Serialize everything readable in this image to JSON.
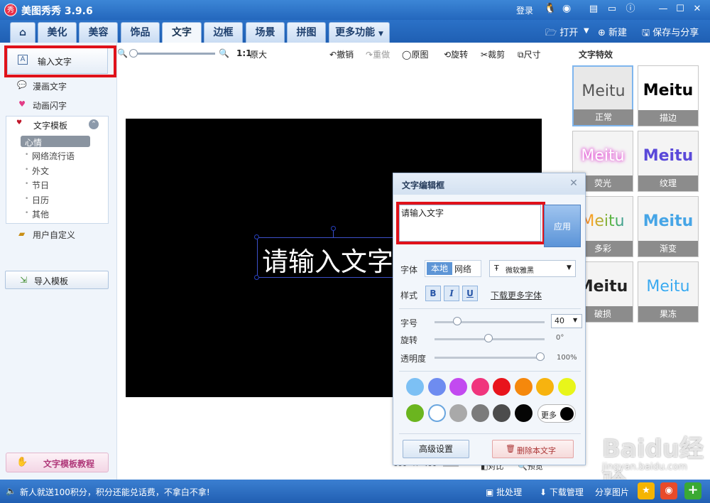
{
  "titlebar": {
    "app_name": "美图秀秀 3.9.6",
    "login": "登录"
  },
  "tabs": [
    "美化",
    "美容",
    "饰品",
    "文字",
    "边框",
    "场景",
    "拼图",
    "更多功能"
  ],
  "header_actions": {
    "open": "打开",
    "new": "新建",
    "save_share": "保存与分享"
  },
  "left_panel": {
    "input_text": "输入文字",
    "comic_text": "漫画文字",
    "animated_text": "动画闪字",
    "template_title": "文字模板",
    "template_items": [
      "心情",
      "网络流行语",
      "外文",
      "节日",
      "日历",
      "其他"
    ],
    "user_custom": "用户自定义",
    "import_template": "导入模板",
    "tutorial": "文字模板教程"
  },
  "toolbar": {
    "ratio": "1:1",
    "original_size": "原大",
    "undo": "撤销",
    "redo": "重做",
    "original": "原图",
    "rotate": "旋转",
    "crop": "裁剪",
    "size": "尺寸"
  },
  "canvas": {
    "text": "请输入文字",
    "width": "600",
    "x_sep": "×",
    "height": "400",
    "exif": "EXIF",
    "compare": "对比",
    "preview": "预览"
  },
  "effects": {
    "title": "文字特效",
    "items": [
      {
        "word": "Meitu",
        "label": "正常"
      },
      {
        "word": "Meitu",
        "label": "描边"
      },
      {
        "word": "Meitu",
        "label": "荧光"
      },
      {
        "word": "Meitu",
        "label": "纹理"
      },
      {
        "word": "Meitu",
        "label": "多彩"
      },
      {
        "word": "Meitu",
        "label": "渐变"
      },
      {
        "word": "Meitu",
        "label": "破损"
      },
      {
        "word": "Meitu",
        "label": "果冻"
      }
    ]
  },
  "editor": {
    "title": "文字编辑框",
    "text_value": "请输入文字",
    "apply": "应用",
    "font_label": "字体",
    "font_local": "本地",
    "font_online": "网络",
    "font_name": "微软雅黑",
    "style_label": "样式",
    "bold": "B",
    "italic": "I",
    "underline": "U",
    "download_fonts": "下载更多字体",
    "size_label": "字号",
    "size_value": "40",
    "rotate_label": "旋转",
    "rotate_value": "0°",
    "opacity_label": "透明度",
    "opacity_value": "100%",
    "opacity_fraction": 1.0,
    "colors_row1": [
      "#7cc0f4",
      "#6e8cf0",
      "#c24af0",
      "#f0357d",
      "#e8141c",
      "#f5880c",
      "#f7b30f",
      "#e8f51a"
    ],
    "colors_row2": [
      "#6bb51f",
      "#ffffff",
      "#a9a9a9",
      "#7b7b7b",
      "#4c4c4c",
      "#050505"
    ],
    "more": "更多",
    "advanced": "高级设置",
    "delete": "删除本文字"
  },
  "statusbar": {
    "notice": "新人就送100积分，积分还能兑话费，不拿白不拿!",
    "batch": "批处理",
    "download_manager": "下载管理",
    "share_image": "分享图片"
  },
  "watermark": {
    "text": "Baidu经验",
    "sub": "jingyan.baidu.com"
  }
}
